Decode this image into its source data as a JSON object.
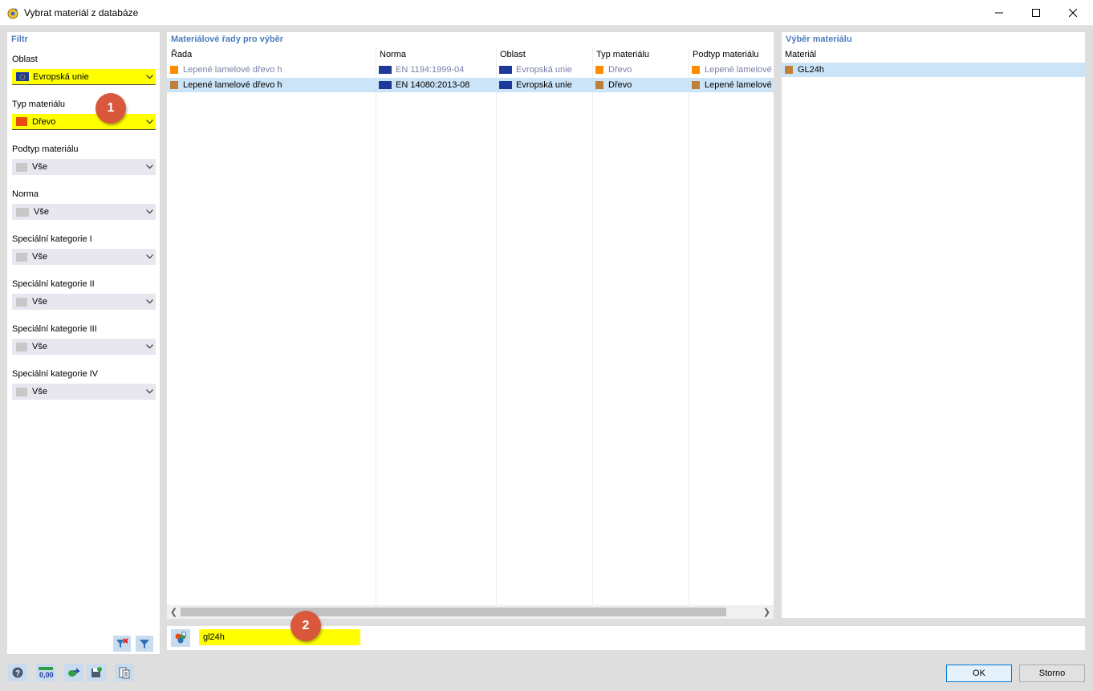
{
  "window": {
    "title": "Vybrat materiál z databáze"
  },
  "filter": {
    "title": "Filtr",
    "fields": [
      {
        "label": "Oblast",
        "value": "Evropská unie",
        "highlighted": true,
        "icon": "eu-flag-icon"
      },
      {
        "label": "Typ materiálu",
        "value": "Dřevo",
        "highlighted": true,
        "icon": "wood-swatch-icon"
      },
      {
        "label": "Podtyp materiálu",
        "value": "Vše",
        "highlighted": false
      },
      {
        "label": "Norma",
        "value": "Vše",
        "highlighted": false
      },
      {
        "label": "Speciální kategorie I",
        "value": "Vše",
        "highlighted": false
      },
      {
        "label": "Speciální kategorie II",
        "value": "Vše",
        "highlighted": false
      },
      {
        "label": "Speciální kategorie III",
        "value": "Vše",
        "highlighted": false
      },
      {
        "label": "Speciální kategorie IV",
        "value": "Vše",
        "highlighted": false
      }
    ]
  },
  "series": {
    "title": "Materiálové řady pro výběr",
    "columns": [
      "Řada",
      "Norma",
      "Oblast",
      "Typ materiálu",
      "Podtyp materiálu"
    ],
    "rows": [
      {
        "rada": "Lepené lamelové dřevo h",
        "norma": "EN 1194:1999-04",
        "oblast": "Evropská unie",
        "typ": "Dřevo",
        "podtyp": "Lepené lamelové",
        "dim": true,
        "selected": false
      },
      {
        "rada": "Lepené lamelové dřevo h",
        "norma": "EN 14080:2013-08",
        "oblast": "Evropská unie",
        "typ": "Dřevo",
        "podtyp": "Lepené lamelové",
        "dim": false,
        "selected": true
      }
    ]
  },
  "material": {
    "title": "Výběr materiálu",
    "column": "Materiál",
    "items": [
      {
        "name": "GL24h",
        "selected": true
      }
    ]
  },
  "search": {
    "value": "gl24h"
  },
  "callouts": [
    "1",
    "2"
  ],
  "buttons": {
    "ok": "OK",
    "cancel": "Storno"
  },
  "colors": {
    "accent": "#4d7dbe",
    "highlight": "#ffff00",
    "selection": "#cce4f7",
    "callout": "#d9583b",
    "orange": "#ff8c00",
    "wood": "#c0803a"
  }
}
